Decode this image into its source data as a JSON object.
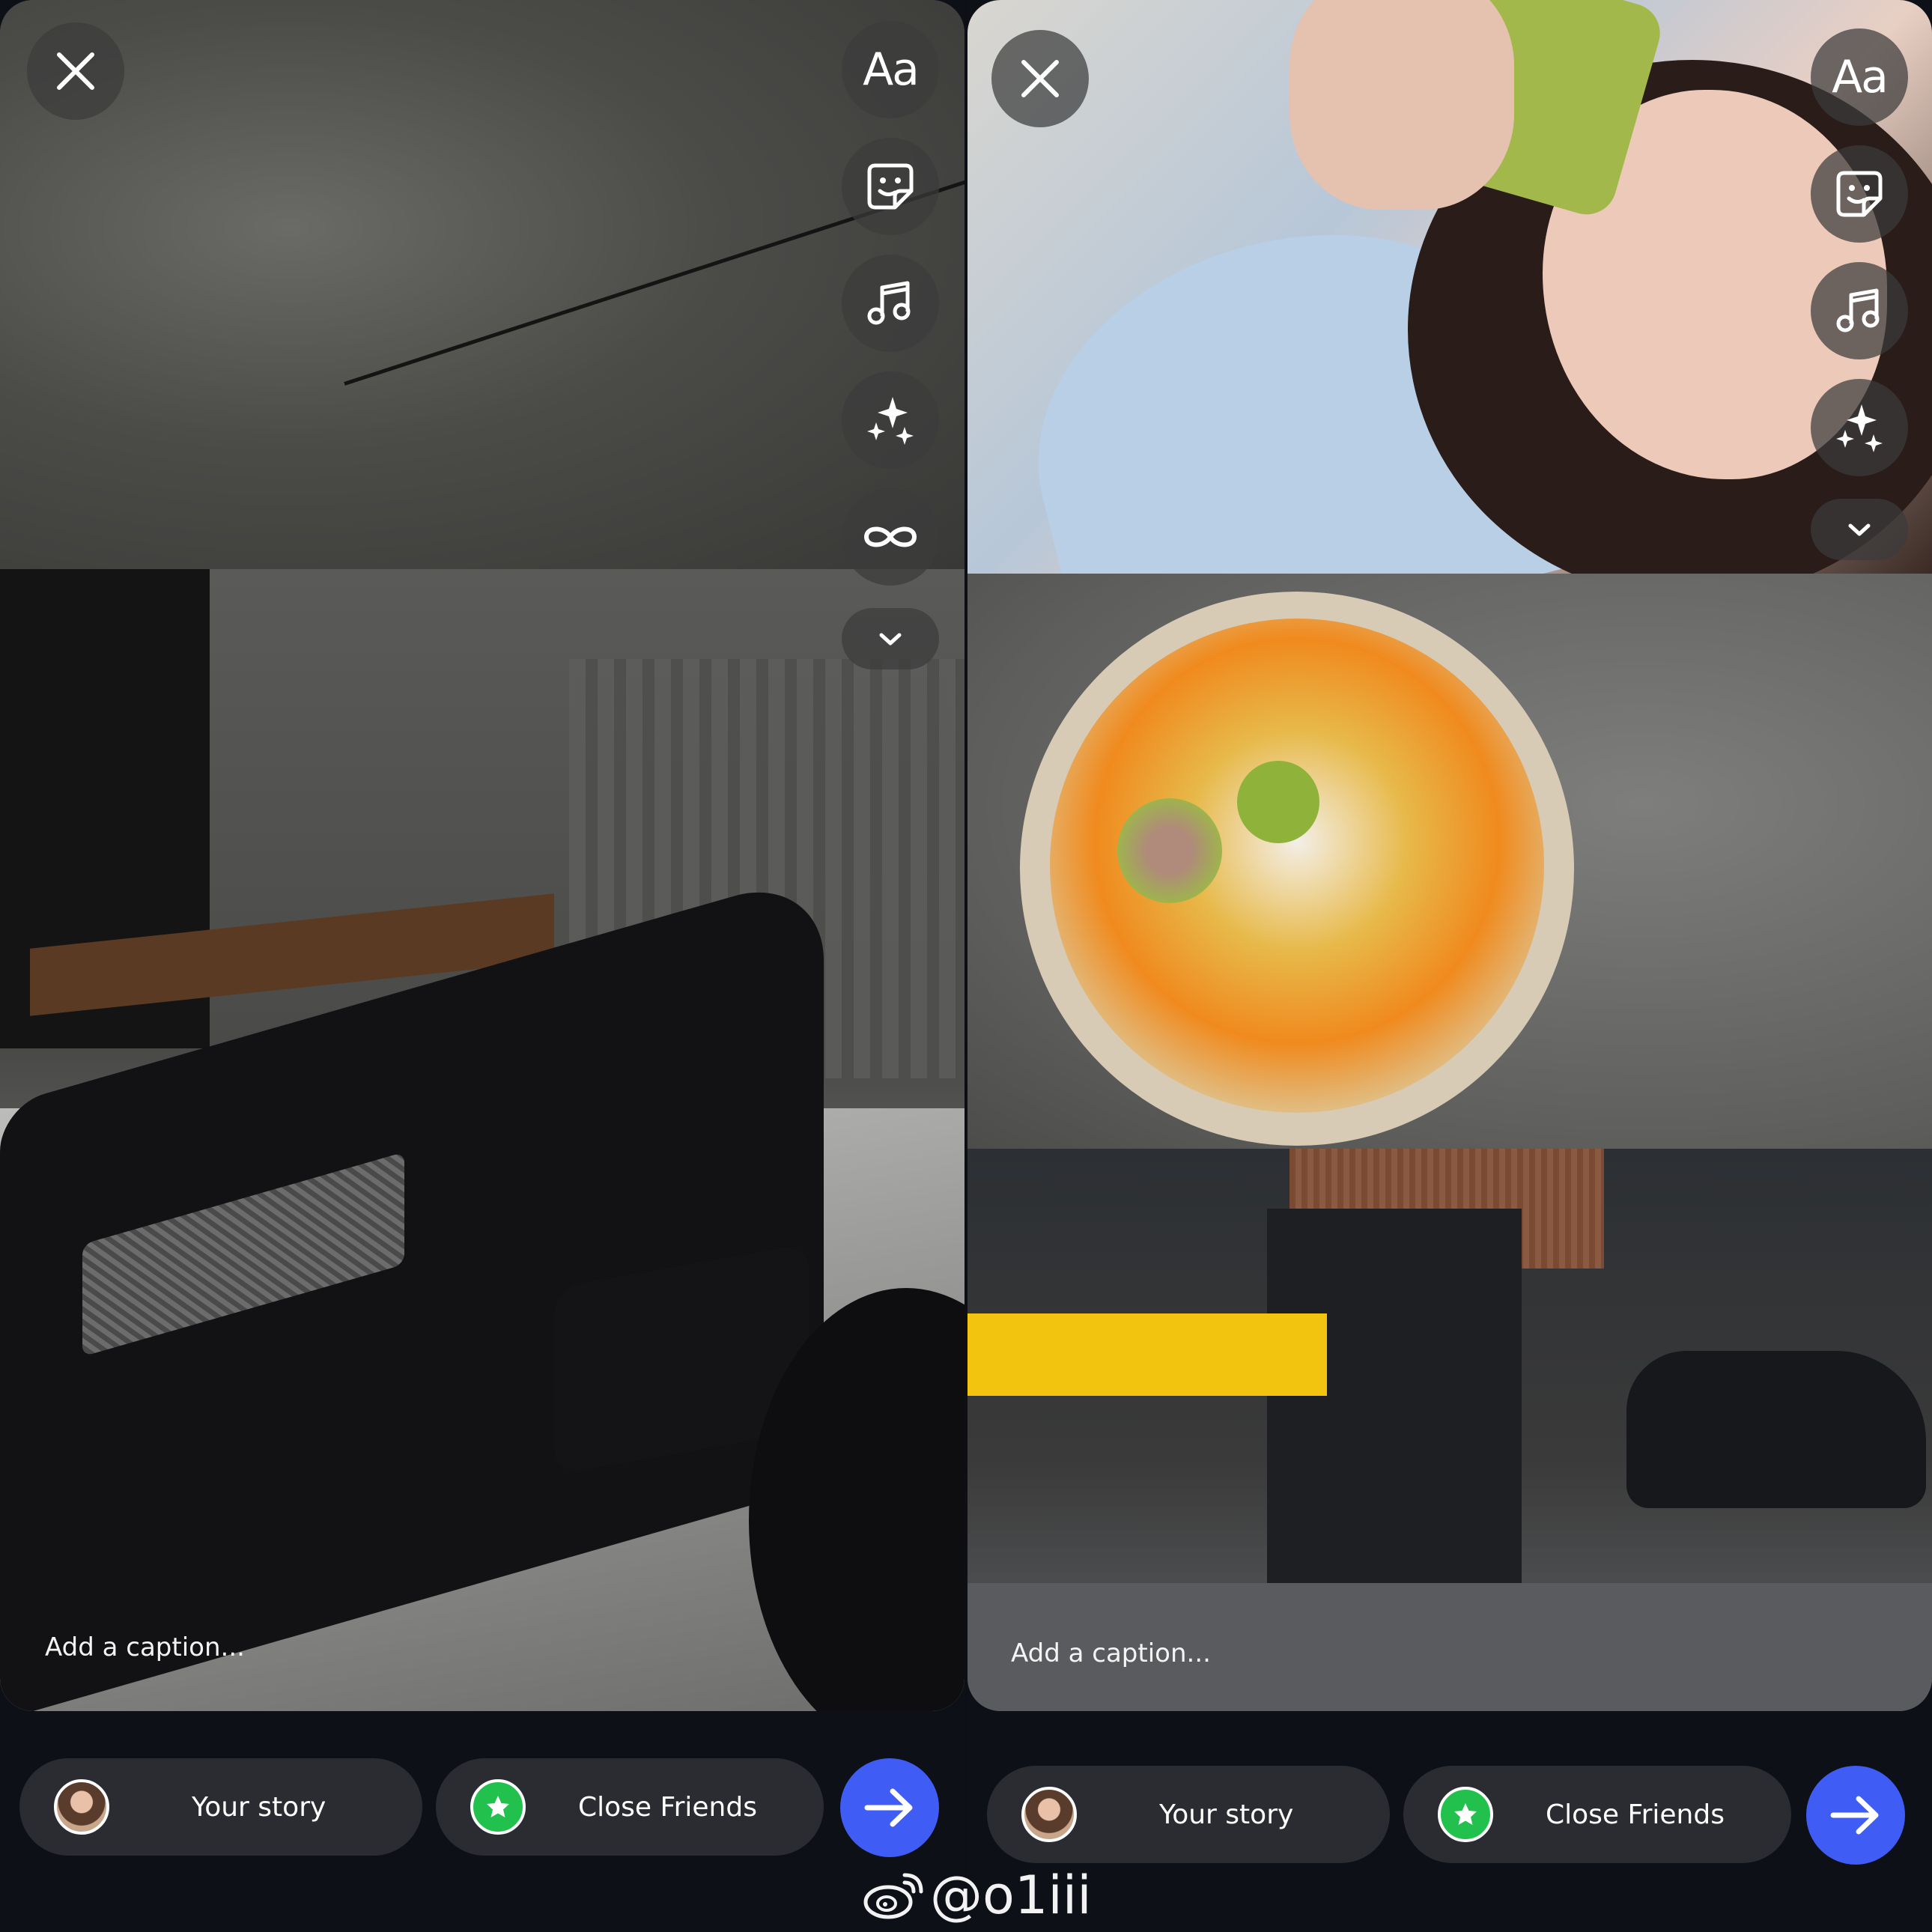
{
  "panels": [
    {
      "id": "left",
      "caption_placeholder": "Add a caption...",
      "tools": {
        "text_label": "Aa"
      },
      "audience": {
        "story_label": "Your story",
        "close_friends_label": "Close Friends"
      }
    },
    {
      "id": "right",
      "caption_placeholder": "Add a caption...",
      "tools": {
        "text_label": "Aa"
      },
      "audience": {
        "story_label": "Your story",
        "close_friends_label": "Close Friends"
      }
    }
  ],
  "icons": {
    "close": "close-icon",
    "text": "text-icon",
    "sticker": "sticker-icon",
    "music": "music-note-icon",
    "effects": "sparkles-icon",
    "boomerang": "infinity-icon",
    "more": "chevron-down-icon",
    "send": "arrow-right-icon",
    "close_friends": "star-icon",
    "watermark": "weibo-icon"
  },
  "colors": {
    "send_button": "#3f5cf5",
    "close_friends_badge": "#22c04c",
    "pill_background": "#2b2c31",
    "tool_background": "#3c3c3c"
  },
  "watermark": {
    "handle": "@o1iii"
  }
}
